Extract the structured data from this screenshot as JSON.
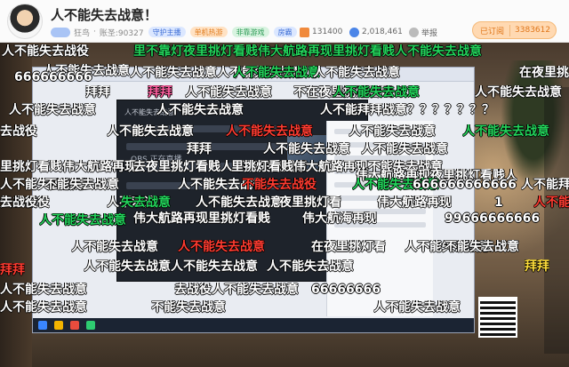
{
  "streamer": {
    "title": "人不能失去战意！",
    "category": "狂鸟",
    "account": "账圣:90327",
    "tag": "守护主播"
  },
  "header": {
    "badges": [
      "单机热游",
      "非靠游戏",
      "房霸"
    ],
    "viewers": "131400",
    "heat": "2,018,461",
    "report_label": "举报",
    "follow_label": "已订阅",
    "follow_count": "3383612"
  },
  "player": {
    "obs_label": "OBS 正在直播",
    "panel_label": "人不能失去战意",
    "danmaku": [
      {
        "text": "人不能失去战役",
        "color": "white"
      },
      {
        "text": "里不靠灯夜里挑灯看贱伟大航路再现里挑灯看贱人不能失去战意",
        "color": "green"
      },
      {
        "text": "人不能失去战意",
        "color": "white"
      },
      {
        "text": "666666666",
        "color": "white"
      },
      {
        "text": "人不能失去战意人不能失去战意",
        "color": "white"
      },
      {
        "text": "人不能失去战意",
        "color": "green"
      },
      {
        "text": "人不能失去战意",
        "color": "white"
      },
      {
        "text": "在夜里挑灯看",
        "color": "white"
      },
      {
        "text": "拜拜",
        "color": "white"
      },
      {
        "text": "拜拜",
        "color": "pink"
      },
      {
        "text": "人不能失去战意",
        "color": "white"
      },
      {
        "text": "不在夜里挑灯看贱",
        "color": "white"
      },
      {
        "text": "人不能失去战意",
        "color": "green"
      },
      {
        "text": "人不能失去战意",
        "color": "white"
      },
      {
        "text": "人不能失去战意",
        "color": "white"
      },
      {
        "text": "人不能失去战意",
        "color": "white"
      },
      {
        "text": "人不能拜拜战意？？？？？？？",
        "color": "white"
      },
      {
        "text": "去战役",
        "color": "white"
      },
      {
        "text": "人不能失去战意",
        "color": "white"
      },
      {
        "text": "人不能失去战意",
        "color": "red"
      },
      {
        "text": "人不能失去战意",
        "color": "white"
      },
      {
        "text": "人不能失去战意",
        "color": "green"
      },
      {
        "text": "拜拜",
        "color": "white"
      },
      {
        "text": "里挑灯看贱伟大航路再现",
        "color": "white"
      },
      {
        "text": "人不能失去战意",
        "color": "white"
      },
      {
        "text": "人不能失去战意",
        "color": "white"
      },
      {
        "text": "人不能失去战意",
        "color": "white"
      },
      {
        "text": "去夜里挑灯看贱人不能失去战意",
        "color": "white"
      },
      {
        "text": "里挑灯看贱伟大航路再现不能失去战意",
        "color": "white"
      },
      {
        "text": "伟大航路再现夜里挑灯看贱人",
        "color": "white"
      },
      {
        "text": "不能失去战意",
        "color": "white"
      },
      {
        "text": "失去战役",
        "color": "white"
      },
      {
        "text": "人不能失去战役",
        "color": "white"
      },
      {
        "text": "不能失去战役",
        "color": "red"
      },
      {
        "text": "人不能失去战意",
        "color": "green"
      },
      {
        "text": "666666666666",
        "color": "white"
      },
      {
        "text": "人不能拜拜",
        "color": "white"
      },
      {
        "text": "去战役",
        "color": "white"
      },
      {
        "text": "人不欢迎",
        "color": "white"
      },
      {
        "text": "失去战意",
        "color": "green"
      },
      {
        "text": "人不能失去战意",
        "color": "white"
      },
      {
        "text": "夜里挑灯看",
        "color": "white"
      },
      {
        "text": "伟大航路再现",
        "color": "white"
      },
      {
        "text": "1",
        "color": "white"
      },
      {
        "text": "人不能拜",
        "color": "red"
      },
      {
        "text": "人不能失去战意",
        "color": "green"
      },
      {
        "text": "伟大航路再现里挑灯看贱",
        "color": "white"
      },
      {
        "text": "伟大航海再现",
        "color": "white"
      },
      {
        "text": "99666666666",
        "color": "white"
      },
      {
        "text": "人不能失去战意",
        "color": "white"
      },
      {
        "text": "人不能失去战意",
        "color": "red"
      },
      {
        "text": "在夜里挑灯看",
        "color": "white"
      },
      {
        "text": "人不能失去战意",
        "color": "white"
      },
      {
        "text": "不能失去战意",
        "color": "white"
      },
      {
        "text": "人不能失去战意",
        "color": "white"
      },
      {
        "text": "拜拜",
        "color": "red"
      },
      {
        "text": "人不能失去战意",
        "color": "white"
      },
      {
        "text": "人不能失去战意",
        "color": "white"
      },
      {
        "text": "拜拜",
        "color": "yellow"
      },
      {
        "text": "人不能失去战意",
        "color": "white"
      },
      {
        "text": "去战役人不能失去战意",
        "color": "white"
      },
      {
        "text": "66666666",
        "color": "white"
      },
      {
        "text": "人不能失去战意",
        "color": "white"
      },
      {
        "text": "不能失去战意",
        "color": "white"
      },
      {
        "text": "人不能失去战意",
        "color": "white"
      }
    ]
  },
  "colors": {
    "accent": "#f5a04a",
    "danmaku_white": "#ffffff",
    "danmaku_green": "#22d35a",
    "danmaku_red": "#ff3b30",
    "danmaku_pink": "#ff5fa0",
    "danmaku_yellow": "#ffde3b"
  },
  "icons": [
    "avatar",
    "viewers-icon",
    "heat-icon",
    "report-icon",
    "follow-icon"
  ]
}
